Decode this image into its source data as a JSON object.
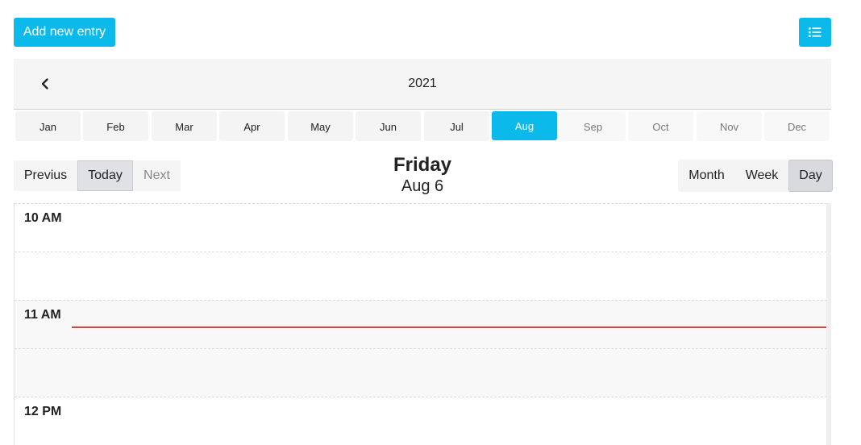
{
  "toolbar": {
    "add_label": "Add new entry",
    "list_icon": "list-icon"
  },
  "year_nav": {
    "year": "2021",
    "prev_icon": "chevron-left-icon"
  },
  "months": [
    {
      "label": "Jan",
      "state": "past"
    },
    {
      "label": "Feb",
      "state": "past"
    },
    {
      "label": "Mar",
      "state": "past"
    },
    {
      "label": "Apr",
      "state": "past"
    },
    {
      "label": "May",
      "state": "past"
    },
    {
      "label": "Jun",
      "state": "past"
    },
    {
      "label": "Jul",
      "state": "past"
    },
    {
      "label": "Aug",
      "state": "active"
    },
    {
      "label": "Sep",
      "state": "future"
    },
    {
      "label": "Oct",
      "state": "future"
    },
    {
      "label": "Nov",
      "state": "future"
    },
    {
      "label": "Dec",
      "state": "future"
    }
  ],
  "nav": {
    "previous": "Previus",
    "today": "Today",
    "next": "Next"
  },
  "day": {
    "weekday": "Friday",
    "date": "Aug 6"
  },
  "views": {
    "month": "Month",
    "week": "Week",
    "day": "Day",
    "selected": "Day"
  },
  "timeline": {
    "hours": [
      "10 AM",
      "11 AM",
      "12 PM"
    ]
  },
  "colors": {
    "accent": "#0bbaeb",
    "now_line": "#d9453a"
  }
}
